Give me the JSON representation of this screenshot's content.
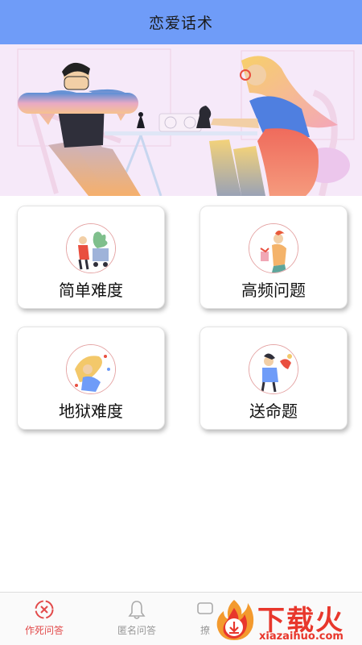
{
  "header": {
    "title": "恋爱话术"
  },
  "cards": [
    {
      "label": "简单难度"
    },
    {
      "label": "高频问题"
    },
    {
      "label": "地狱难度"
    },
    {
      "label": "送命题"
    }
  ],
  "tabs": [
    {
      "label": "作死问答",
      "icon": "circle-x-icon",
      "active": true
    },
    {
      "label": "匿名问答",
      "icon": "bell-icon",
      "active": false
    },
    {
      "label": "撩",
      "icon": "chat-icon",
      "active": false
    }
  ],
  "watermark": {
    "text": "下载火",
    "url": "xiazaihuo.com",
    "icon": "flame-download-icon"
  },
  "colors": {
    "header": "#6f9cf8",
    "active_tab": "#e24a4a",
    "inactive_tab": "#999999",
    "watermark": "#e8372c"
  }
}
